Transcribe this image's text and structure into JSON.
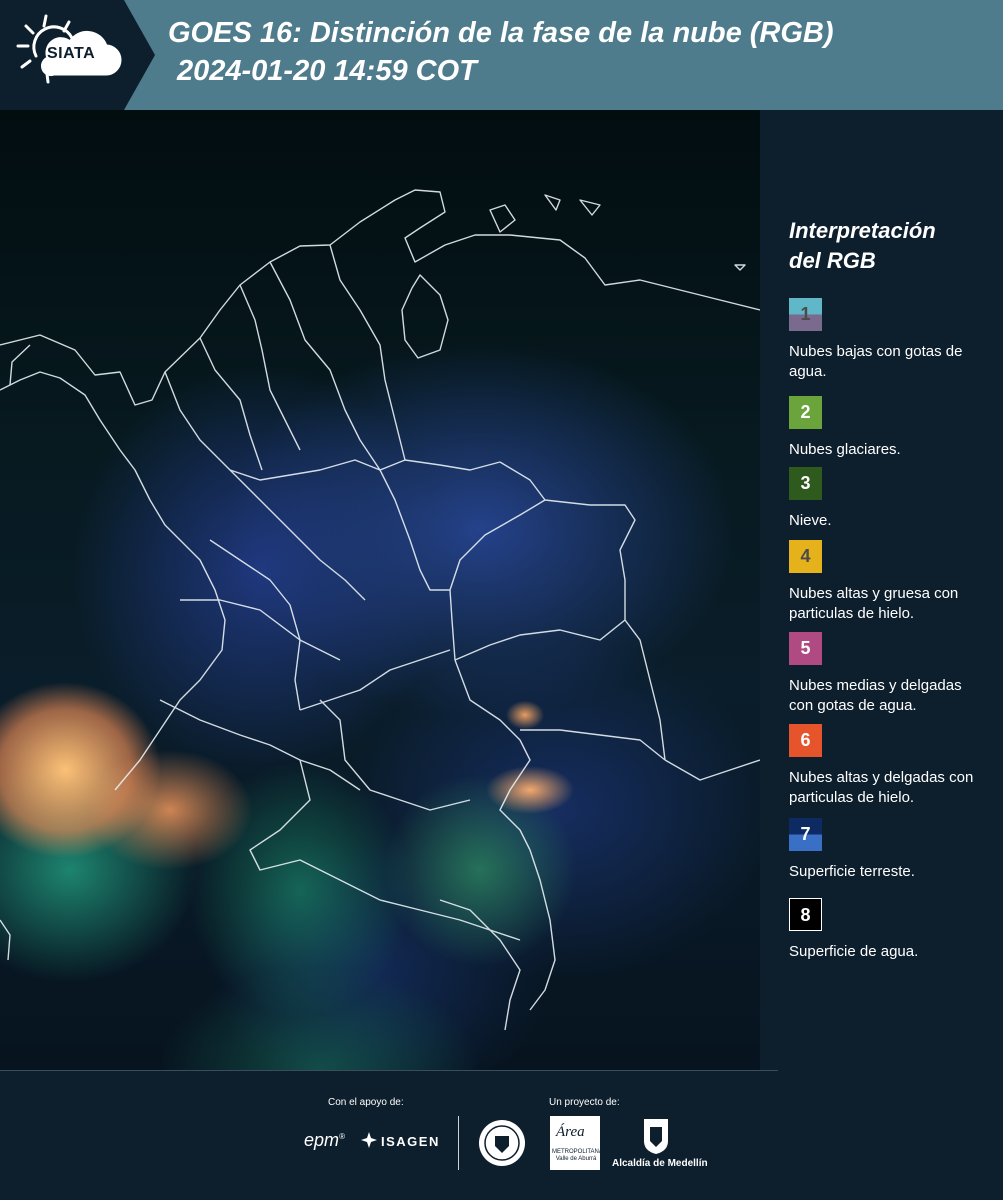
{
  "header": {
    "logo_text": "SIATA",
    "title_line1": "GOES 16: Distinción de la fase de la nube (RGB)",
    "title_line2": "2024-01-20 14:59 COT"
  },
  "legend": {
    "title": "Interpretación del RGB",
    "items": [
      {
        "number": "1",
        "description": "Nubes bajas con gotas de agua.",
        "color_top": "#5fb7c7",
        "color_bottom": "#7a6a8e"
      },
      {
        "number": "2",
        "description": "Nubes glaciares.",
        "color_top": "#6ba43a",
        "color_bottom": "#6ba43a"
      },
      {
        "number": "3",
        "description": "Nieve.",
        "color_top": "#2e5a1e",
        "color_bottom": "#2e5a1e"
      },
      {
        "number": "4",
        "description": "Nubes altas y gruesa con particulas de hielo.",
        "color_top": "#e6b21c",
        "color_bottom": "#e6b21c"
      },
      {
        "number": "5",
        "description": "Nubes medias y delgadas con gotas de agua.",
        "color_top": "#b04a82",
        "color_bottom": "#b04a82"
      },
      {
        "number": "6",
        "description": "Nubes altas y delgadas con particulas de hielo.",
        "color_top": "#e5542b",
        "color_bottom": "#e5542b"
      },
      {
        "number": "7",
        "description": "Superficie terreste.",
        "color_top": "#0e2a63",
        "color_bottom": "#3a6fc6"
      },
      {
        "number": "8",
        "description": "Superficie de agua.",
        "color_top": "#000000",
        "color_bottom": "#000000"
      }
    ]
  },
  "footer": {
    "support_label": "Con el apoyo de:",
    "project_label": "Un proyecto de:",
    "epm": "epm",
    "isagen": "ISAGEN",
    "area_word": "Área",
    "area_sub": "METROPOLITANA Valle de Aburrá",
    "alcaldia": "Alcaldía de Medellín"
  },
  "colors": {
    "header_bg": "#4f7c8c",
    "panel_bg": "#0d1e2c"
  }
}
